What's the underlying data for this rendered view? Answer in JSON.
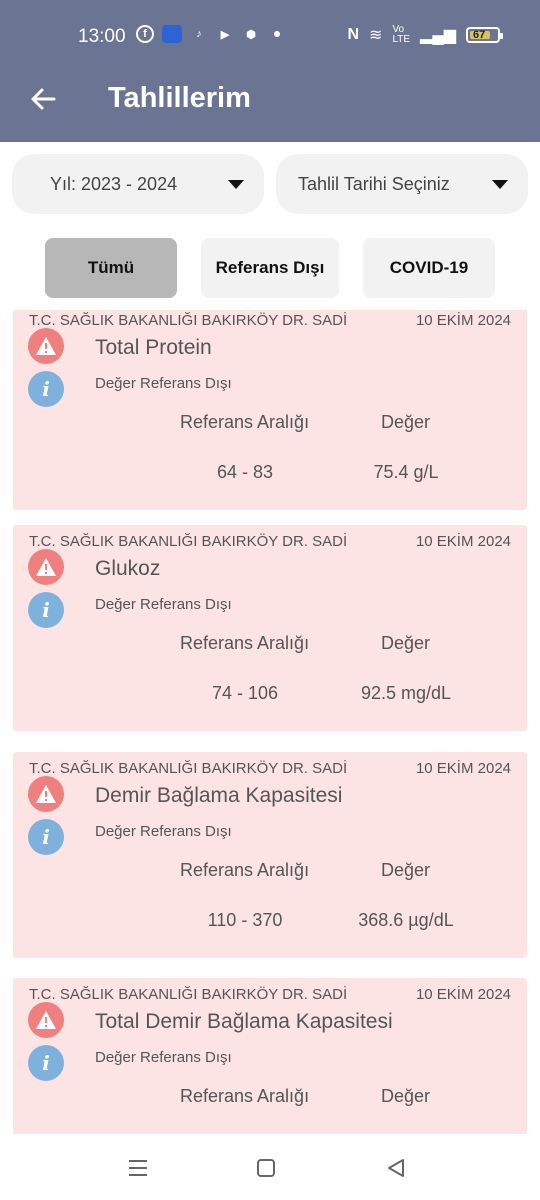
{
  "status_bar": {
    "time": "13:00",
    "icons": [
      "facebook-icon",
      "nfc-radio-icon",
      "tiktok-icon",
      "youtube-icon",
      "box-icon",
      "dot-icon"
    ],
    "right_icons": [
      "nfc-icon",
      "wifi-icon",
      "volte-icon",
      "signal-icon"
    ],
    "battery": "67"
  },
  "app_bar": {
    "title": "Tahlillerim"
  },
  "filters": {
    "year": "Yıl: 2023 - 2024",
    "date_placeholder": "Tahlil Tarihi Seçiniz"
  },
  "tabs": [
    {
      "label": "Tümü",
      "active": true
    },
    {
      "label": "Referans Dışı",
      "active": false
    },
    {
      "label": "COVID-19",
      "active": false
    }
  ],
  "results": [
    {
      "hospital": "T.C. SAĞLIK BAKANLIĞI BAKIRKÖY DR. SADİ",
      "date": "10 EKİM 2024",
      "name": "Total Protein",
      "status": "Değer Referans Dışı",
      "ref_label": "Referans Aralığı",
      "value_label": "Değer",
      "ref_range": "64 - 83",
      "value": "75.4 g/L"
    },
    {
      "hospital": "T.C. SAĞLIK BAKANLIĞI BAKIRKÖY DR. SADİ",
      "date": "10 EKİM 2024",
      "name": "Glukoz",
      "status": "Değer Referans Dışı",
      "ref_label": "Referans Aralığı",
      "value_label": "Değer",
      "ref_range": "74 - 106",
      "value": "92.5 mg/dL"
    },
    {
      "hospital": "T.C. SAĞLIK BAKANLIĞI BAKIRKÖY DR. SADİ",
      "date": "10 EKİM 2024",
      "name": "Demir Bağlama Kapasitesi",
      "status": "Değer Referans Dışı",
      "ref_label": "Referans Aralığı",
      "value_label": "Değer",
      "ref_range": "110 - 370",
      "value": "368.6 µg/dL"
    },
    {
      "hospital": "T.C. SAĞLIK BAKANLIĞI BAKIRKÖY DR. SADİ",
      "date": "10 EKİM 2024",
      "name": "Total Demir Bağlama Kapasitesi",
      "status": "Değer Referans Dışı",
      "ref_label": "Referans Aralığı",
      "value_label": "Değer",
      "ref_range": "",
      "value": ""
    }
  ],
  "nav": [
    "recents-icon",
    "home-icon",
    "back-icon"
  ],
  "colors": {
    "header": "#6b7593",
    "card": "#fde4e4",
    "warning": "#f07f7f",
    "info": "#7fb1dd",
    "active_tab": "#b7b7b7"
  }
}
